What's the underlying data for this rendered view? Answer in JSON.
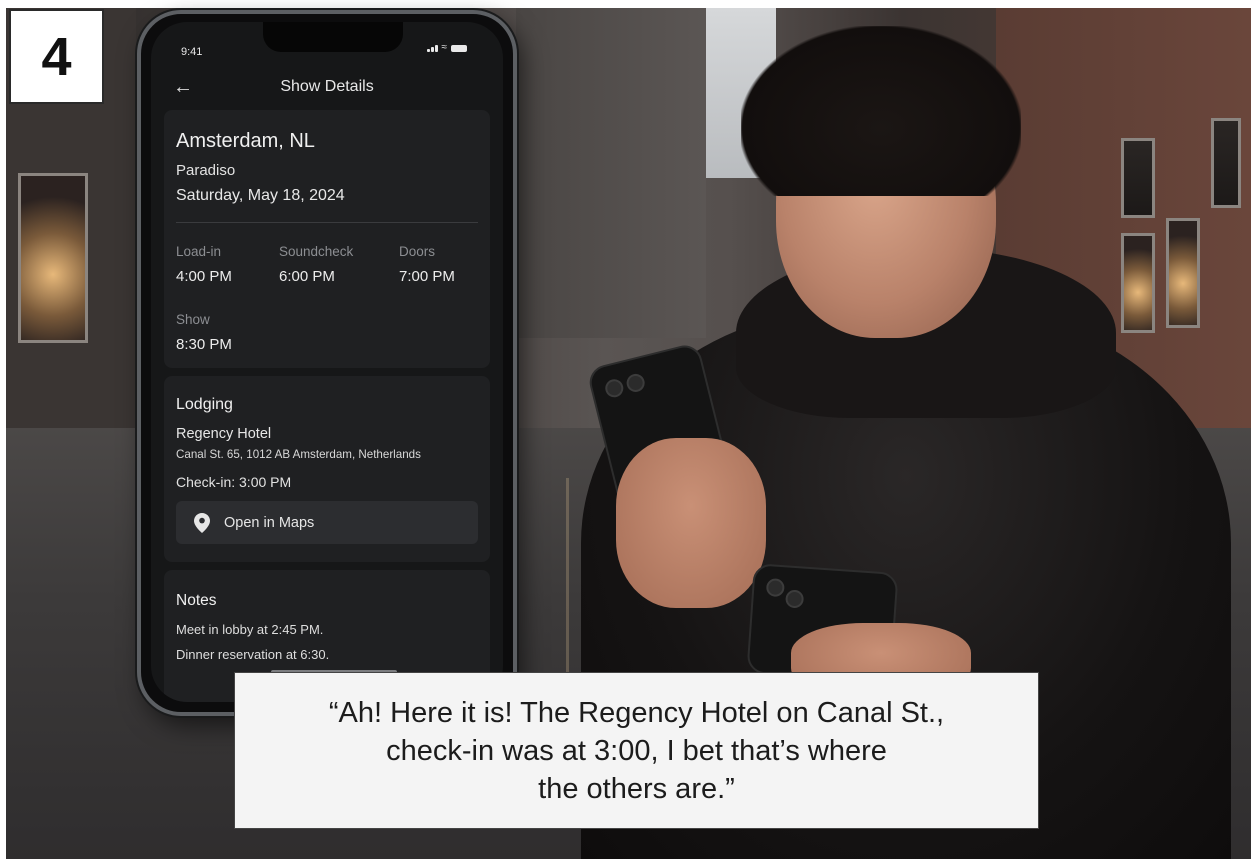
{
  "step": {
    "number": "4"
  },
  "phone": {
    "status_time": "9:41",
    "nav": {
      "title": "Show Details"
    },
    "show": {
      "city": "Amsterdam, NL",
      "venue": "Paradiso",
      "date": "Saturday, May 18, 2024",
      "schedule": [
        {
          "label": "Load-in",
          "value": "4:00 PM"
        },
        {
          "label": "Soundcheck",
          "value": "6:00 PM"
        },
        {
          "label": "Doors",
          "value": "7:00 PM"
        },
        {
          "label": "Show",
          "value": "8:30 PM"
        }
      ]
    },
    "lodging": {
      "heading": "Lodging",
      "hotel": "Regency Hotel",
      "address": "Canal St. 65, 1012 AB Amsterdam, Netherlands",
      "checkin": "Check-in: 3:00 PM",
      "maps_button": "Open in Maps",
      "maps_icon": "map-pin-icon"
    },
    "notes": {
      "heading": "Notes",
      "lines": [
        "Meet in lobby at 2:45 PM.",
        "Dinner reservation at 6:30."
      ]
    }
  },
  "caption": {
    "text": "“Ah! Here it is! The Regency Hotel on Canal St.,\ncheck-in was at 3:00, I bet that’s where\nthe others are.”"
  },
  "colors": {
    "screen_bg": "#161718",
    "card_bg": "#1f2022",
    "label_gray": "#8c8e92",
    "caption_bg": "#f4f4f4"
  }
}
